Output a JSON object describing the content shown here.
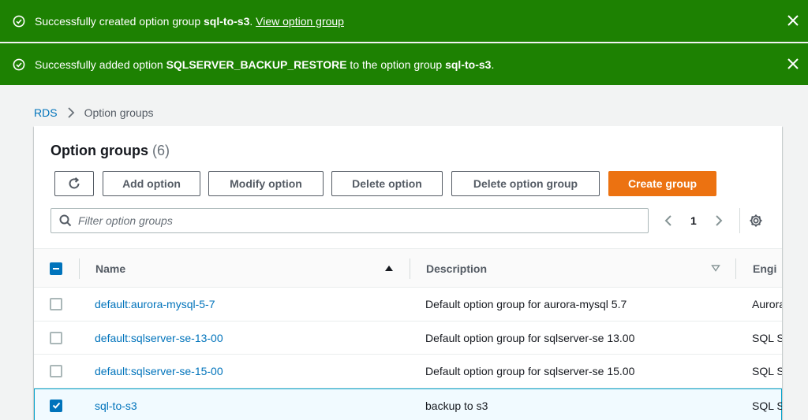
{
  "flash": [
    {
      "prefix": "Successfully created option group ",
      "bold": "sql-to-s3",
      "suffix": ". ",
      "link": "View option group",
      "icon": "check-circle-icon"
    },
    {
      "prefix": "Successfully added option ",
      "bold": "SQLSERVER_BACKUP_RESTORE",
      "mid": " to the option group ",
      "bold2": "sql-to-s3",
      "suffix": ".",
      "icon": "check-circle-icon"
    }
  ],
  "breadcrumb": {
    "root": "RDS",
    "current": "Option groups"
  },
  "panel": {
    "title": "Option groups",
    "count": "(6)",
    "buttons": {
      "add": "Add option",
      "modify": "Modify option",
      "delete": "Delete option",
      "delete_group": "Delete option group",
      "create": "Create group"
    },
    "filter_placeholder": "Filter option groups",
    "page": "1"
  },
  "table": {
    "headers": {
      "name": "Name",
      "description": "Description",
      "engine": "Engi"
    },
    "rows": [
      {
        "name": "default:aurora-mysql-5-7",
        "description": "Default option group for aurora-mysql 5.7",
        "engine": "Aurora",
        "checked": false
      },
      {
        "name": "default:sqlserver-se-13-00",
        "description": "Default option group for sqlserver-se 13.00",
        "engine": "SQL S",
        "checked": false
      },
      {
        "name": "default:sqlserver-se-15-00",
        "description": "Default option group for sqlserver-se 15.00",
        "engine": "SQL S",
        "checked": false
      },
      {
        "name": "sql-to-s3",
        "description": "backup to s3",
        "engine": "SQL S",
        "checked": true
      }
    ]
  },
  "colors": {
    "success": "#1d8102",
    "primary": "#ec7211",
    "link": "#0073bb"
  }
}
